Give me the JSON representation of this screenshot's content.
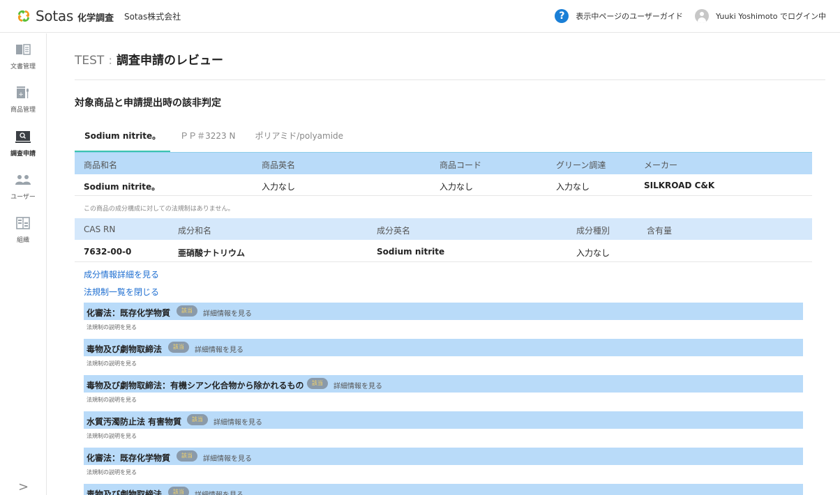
{
  "header": {
    "brand": "Sotas",
    "brand_sub": "化学調査",
    "company": "Sotas株式会社",
    "guide": "表示中ページのユーザーガイド",
    "login": "Yuuki Yoshimoto でログイン中",
    "help_symbol": "?",
    "colors": {
      "logo_green": "#5bbf3a",
      "logo_orange": "#f39c1f",
      "help_blue": "#1a7fd6"
    }
  },
  "sidebar": {
    "items": [
      {
        "label": "文書管理",
        "icon": "book-icon"
      },
      {
        "label": "商品管理",
        "icon": "product-icon"
      },
      {
        "label": "調査申請",
        "icon": "search-icon",
        "active": true
      },
      {
        "label": "ユーザー",
        "icon": "users-icon"
      },
      {
        "label": "組織",
        "icon": "building-icon"
      }
    ],
    "expand_symbol": ">"
  },
  "page": {
    "project": "TEST",
    "separator": ":",
    "title": "調査申請のレビュー",
    "section_title": "対象商品と申請提出時の該非判定"
  },
  "tabs": [
    {
      "label": "Sodium nitrite。",
      "active": true
    },
    {
      "label": "ＰＰ＃3223 N"
    },
    {
      "label": "ポリアミド/polyamide"
    }
  ],
  "product_table": {
    "headers": [
      "商品和名",
      "商品英名",
      "商品コード",
      "グリーン調達",
      "メーカー"
    ],
    "row": [
      "Sodium nitrite。",
      "入力なし",
      "入力なし",
      "入力なし",
      "SILKROAD C&K"
    ]
  },
  "no_regulation_note": "この商品の成分構成に対しての法規制はありません。",
  "component_table": {
    "headers": [
      "CAS RN",
      "成分和名",
      "成分英名",
      "成分種別",
      "含有量"
    ],
    "row": [
      "7632-00-0",
      "亜硝酸ナトリウム",
      "Sodium nitrite",
      "入力なし",
      ""
    ]
  },
  "links": {
    "component_detail": "成分情報詳細を見る",
    "close_law_list": "法規制一覧を閉じる"
  },
  "laws": [
    {
      "name": "化審法：既存化学物質",
      "badge": "該当",
      "detail": "詳細情報を見る",
      "desc": "法規制の説明を見る"
    },
    {
      "name": "毒物及び劇物取締法",
      "badge": "該当",
      "detail": "詳細情報を見る",
      "desc": "法規制の説明を見る"
    },
    {
      "name": "毒物及び劇物取締法：有機シアン化合物から除かれるもの",
      "badge": "該当",
      "detail": "詳細情報を見る",
      "desc": "法規制の説明を見る"
    },
    {
      "name": "水質汚濁防止法 有害物質",
      "badge": "該当",
      "detail": "詳細情報を見る",
      "desc": "法規制の説明を見る"
    },
    {
      "name": "化審法：既存化学物質",
      "badge": "該当",
      "detail": "詳細情報を見る",
      "desc": "法規制の説明を見る"
    },
    {
      "name": "毒物及び劇物取締法",
      "badge": "該当",
      "detail": "詳細情報を見る",
      "desc": ""
    }
  ]
}
